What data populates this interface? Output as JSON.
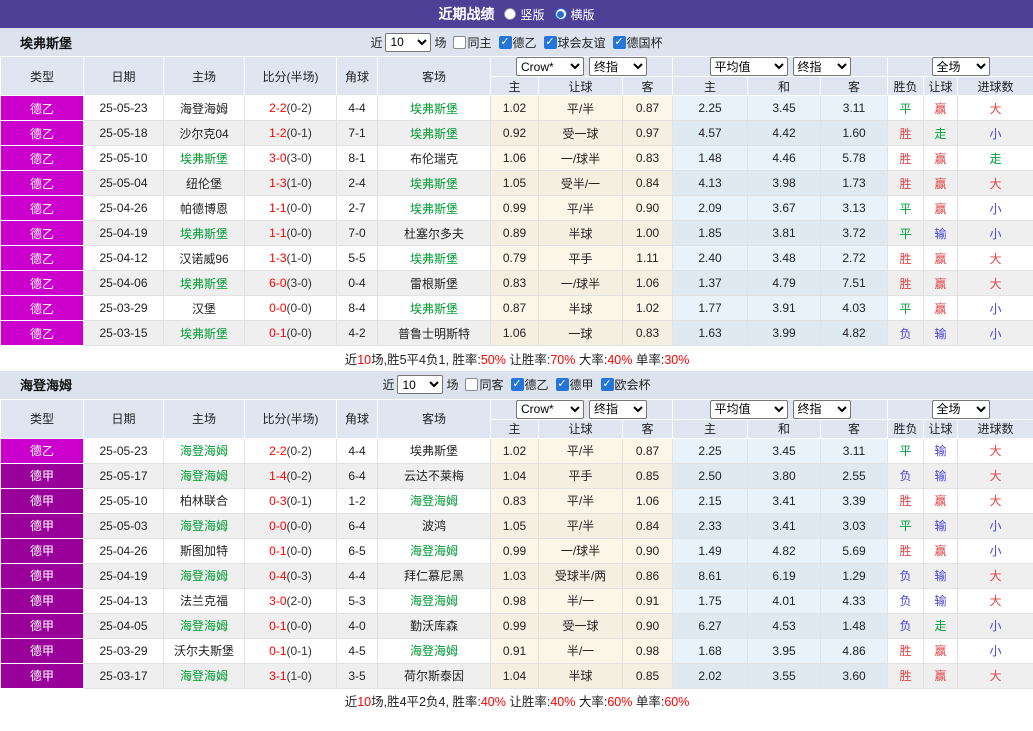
{
  "title_bar": {
    "title": "近期战绩",
    "vertical_label": "竖版",
    "vertical_checked": false,
    "horizontal_label": "横版",
    "horizontal_checked": true
  },
  "colors": {
    "topbar": "#4e4097",
    "league_de2": "#cc00cc",
    "league_de1": "#990099",
    "team_highlight": "#009933",
    "score_red": "#ff0000",
    "win_red": "#e04545",
    "draw_green": "#00a03c",
    "loss_blue": "#4545e0"
  },
  "table_header": {
    "left_cols": [
      "类型",
      "日期",
      "主场",
      "比分(半场)",
      "角球",
      "客场"
    ],
    "odds_groups": [
      {
        "selects": [
          "Crow*",
          "终指"
        ]
      },
      {
        "selects": [
          "平均值",
          "终指"
        ]
      },
      {
        "selects": [
          "全场"
        ]
      }
    ],
    "sub_cols": [
      "主",
      "让球",
      "客",
      "主",
      "和",
      "客",
      "胜负",
      "让球",
      "进球数"
    ]
  },
  "sections": [
    {
      "team": "埃弗斯堡",
      "filter": {
        "near_label": "近",
        "count": "10",
        "games_label": "场",
        "same_label": "同主",
        "same_checked": false,
        "leagues": [
          "德乙",
          "球会友谊",
          "德国杯"
        ]
      },
      "rows": [
        {
          "league": "德乙",
          "lc": "de2",
          "date": "25-05-23",
          "home": "海登海姆",
          "hg": false,
          "score": "2-2",
          "half": "(0-2)",
          "corner": "4-4",
          "away": "埃弗斯堡",
          "ag": true,
          "odds": [
            "1.02",
            "平/半",
            "0.87",
            "2.25",
            "3.45",
            "3.11"
          ],
          "results": [
            [
              "平",
              "g"
            ],
            [
              "赢",
              "r"
            ],
            [
              "大",
              "r"
            ]
          ]
        },
        {
          "league": "德乙",
          "lc": "de2",
          "date": "25-05-18",
          "home": "沙尔克04",
          "hg": false,
          "score": "1-2",
          "half": "(0-1)",
          "corner": "7-1",
          "away": "埃弗斯堡",
          "ag": true,
          "odds": [
            "0.92",
            "受一球",
            "0.97",
            "4.57",
            "4.42",
            "1.60"
          ],
          "results": [
            [
              "胜",
              "r"
            ],
            [
              "走",
              "g"
            ],
            [
              "小",
              "b"
            ]
          ]
        },
        {
          "league": "德乙",
          "lc": "de2",
          "date": "25-05-10",
          "home": "埃弗斯堡",
          "hg": true,
          "score": "3-0",
          "half": "(3-0)",
          "corner": "8-1",
          "away": "布伦瑞克",
          "ag": false,
          "odds": [
            "1.06",
            "一/球半",
            "0.83",
            "1.48",
            "4.46",
            "5.78"
          ],
          "results": [
            [
              "胜",
              "r"
            ],
            [
              "赢",
              "r"
            ],
            [
              "走",
              "g"
            ]
          ]
        },
        {
          "league": "德乙",
          "lc": "de2",
          "date": "25-05-04",
          "home": "纽伦堡",
          "hg": false,
          "score": "1-3",
          "half": "(1-0)",
          "corner": "2-4",
          "away": "埃弗斯堡",
          "ag": true,
          "odds": [
            "1.05",
            "受半/一",
            "0.84",
            "4.13",
            "3.98",
            "1.73"
          ],
          "results": [
            [
              "胜",
              "r"
            ],
            [
              "赢",
              "r"
            ],
            [
              "大",
              "r"
            ]
          ]
        },
        {
          "league": "德乙",
          "lc": "de2",
          "date": "25-04-26",
          "home": "帕德博恩",
          "hg": false,
          "score": "1-1",
          "half": "(0-0)",
          "corner": "2-7",
          "away": "埃弗斯堡",
          "ag": true,
          "odds": [
            "0.99",
            "平/半",
            "0.90",
            "2.09",
            "3.67",
            "3.13"
          ],
          "results": [
            [
              "平",
              "g"
            ],
            [
              "赢",
              "r"
            ],
            [
              "小",
              "b"
            ]
          ]
        },
        {
          "league": "德乙",
          "lc": "de2",
          "date": "25-04-19",
          "home": "埃弗斯堡",
          "hg": true,
          "score": "1-1",
          "half": "(0-0)",
          "corner": "7-0",
          "away": "杜塞尔多夫",
          "ag": false,
          "odds": [
            "0.89",
            "半球",
            "1.00",
            "1.85",
            "3.81",
            "3.72"
          ],
          "results": [
            [
              "平",
              "g"
            ],
            [
              "输",
              "b"
            ],
            [
              "小",
              "b"
            ]
          ]
        },
        {
          "league": "德乙",
          "lc": "de2",
          "date": "25-04-12",
          "home": "汉诺威96",
          "hg": false,
          "score": "1-3",
          "half": "(1-0)",
          "corner": "5-5",
          "away": "埃弗斯堡",
          "ag": true,
          "odds": [
            "0.79",
            "平手",
            "1.11",
            "2.40",
            "3.48",
            "2.72"
          ],
          "results": [
            [
              "胜",
              "r"
            ],
            [
              "赢",
              "r"
            ],
            [
              "大",
              "r"
            ]
          ]
        },
        {
          "league": "德乙",
          "lc": "de2",
          "date": "25-04-06",
          "home": "埃弗斯堡",
          "hg": true,
          "score": "6-0",
          "half": "(3-0)",
          "corner": "0-4",
          "away": "雷根斯堡",
          "ag": false,
          "odds": [
            "0.83",
            "一/球半",
            "1.06",
            "1.37",
            "4.79",
            "7.51"
          ],
          "results": [
            [
              "胜",
              "r"
            ],
            [
              "赢",
              "r"
            ],
            [
              "大",
              "r"
            ]
          ]
        },
        {
          "league": "德乙",
          "lc": "de2",
          "date": "25-03-29",
          "home": "汉堡",
          "hg": false,
          "score": "0-0",
          "half": "(0-0)",
          "corner": "8-4",
          "away": "埃弗斯堡",
          "ag": true,
          "odds": [
            "0.87",
            "半球",
            "1.02",
            "1.77",
            "3.91",
            "4.03"
          ],
          "results": [
            [
              "平",
              "g"
            ],
            [
              "赢",
              "r"
            ],
            [
              "小",
              "b"
            ]
          ]
        },
        {
          "league": "德乙",
          "lc": "de2",
          "date": "25-03-15",
          "home": "埃弗斯堡",
          "hg": true,
          "score": "0-1",
          "half": "(0-0)",
          "corner": "4-2",
          "away": "普鲁士明斯特",
          "ag": false,
          "odds": [
            "1.06",
            "一球",
            "0.83",
            "1.63",
            "3.99",
            "4.82"
          ],
          "results": [
            [
              "负",
              "b"
            ],
            [
              "输",
              "b"
            ],
            [
              "小",
              "b"
            ]
          ]
        }
      ],
      "summary": [
        [
          "近",
          "k"
        ],
        [
          "10",
          "r"
        ],
        [
          "场,胜5平4负1, 胜率:",
          "k"
        ],
        [
          "50%",
          "r"
        ],
        [
          " 让胜率:",
          "k"
        ],
        [
          "70%",
          "r"
        ],
        [
          " 大率:",
          "k"
        ],
        [
          "40%",
          "r"
        ],
        [
          " 单率:",
          "k"
        ],
        [
          "30%",
          "r"
        ]
      ]
    },
    {
      "team": "海登海姆",
      "filter": {
        "near_label": "近",
        "count": "10",
        "games_label": "场",
        "same_label": "同客",
        "same_checked": false,
        "leagues": [
          "德乙",
          "德甲",
          "欧会杯"
        ]
      },
      "rows": [
        {
          "league": "德乙",
          "lc": "de2",
          "date": "25-05-23",
          "home": "海登海姆",
          "hg": true,
          "score": "2-2",
          "half": "(0-2)",
          "corner": "4-4",
          "away": "埃弗斯堡",
          "ag": false,
          "odds": [
            "1.02",
            "平/半",
            "0.87",
            "2.25",
            "3.45",
            "3.11"
          ],
          "results": [
            [
              "平",
              "g"
            ],
            [
              "输",
              "b"
            ],
            [
              "大",
              "r"
            ]
          ]
        },
        {
          "league": "德甲",
          "lc": "de1",
          "date": "25-05-17",
          "home": "海登海姆",
          "hg": true,
          "score": "1-4",
          "half": "(0-2)",
          "corner": "6-4",
          "away": "云达不莱梅",
          "ag": false,
          "odds": [
            "1.04",
            "平手",
            "0.85",
            "2.50",
            "3.80",
            "2.55"
          ],
          "results": [
            [
              "负",
              "b"
            ],
            [
              "输",
              "b"
            ],
            [
              "大",
              "r"
            ]
          ]
        },
        {
          "league": "德甲",
          "lc": "de1",
          "date": "25-05-10",
          "home": "柏林联合",
          "hg": false,
          "score": "0-3",
          "half": "(0-1)",
          "corner": "1-2",
          "away": "海登海姆",
          "ag": true,
          "odds": [
            "0.83",
            "平/半",
            "1.06",
            "2.15",
            "3.41",
            "3.39"
          ],
          "results": [
            [
              "胜",
              "r"
            ],
            [
              "赢",
              "r"
            ],
            [
              "大",
              "r"
            ]
          ]
        },
        {
          "league": "德甲",
          "lc": "de1",
          "date": "25-05-03",
          "home": "海登海姆",
          "hg": true,
          "score": "0-0",
          "half": "(0-0)",
          "corner": "6-4",
          "away": "波鸿",
          "ag": false,
          "odds": [
            "1.05",
            "平/半",
            "0.84",
            "2.33",
            "3.41",
            "3.03"
          ],
          "results": [
            [
              "平",
              "g"
            ],
            [
              "输",
              "b"
            ],
            [
              "小",
              "b"
            ]
          ]
        },
        {
          "league": "德甲",
          "lc": "de1",
          "date": "25-04-26",
          "home": "斯图加特",
          "hg": false,
          "score": "0-1",
          "half": "(0-0)",
          "corner": "6-5",
          "away": "海登海姆",
          "ag": true,
          "odds": [
            "0.99",
            "一/球半",
            "0.90",
            "1.49",
            "4.82",
            "5.69"
          ],
          "results": [
            [
              "胜",
              "r"
            ],
            [
              "赢",
              "r"
            ],
            [
              "小",
              "b"
            ]
          ]
        },
        {
          "league": "德甲",
          "lc": "de1",
          "date": "25-04-19",
          "home": "海登海姆",
          "hg": true,
          "score": "0-4",
          "half": "(0-3)",
          "corner": "4-4",
          "away": "拜仁慕尼黑",
          "ag": false,
          "odds": [
            "1.03",
            "受球半/两",
            "0.86",
            "8.61",
            "6.19",
            "1.29"
          ],
          "results": [
            [
              "负",
              "b"
            ],
            [
              "输",
              "b"
            ],
            [
              "大",
              "r"
            ]
          ]
        },
        {
          "league": "德甲",
          "lc": "de1",
          "date": "25-04-13",
          "home": "法兰克福",
          "hg": false,
          "score": "3-0",
          "half": "(2-0)",
          "corner": "5-3",
          "away": "海登海姆",
          "ag": true,
          "odds": [
            "0.98",
            "半/一",
            "0.91",
            "1.75",
            "4.01",
            "4.33"
          ],
          "results": [
            [
              "负",
              "b"
            ],
            [
              "输",
              "b"
            ],
            [
              "大",
              "r"
            ]
          ]
        },
        {
          "league": "德甲",
          "lc": "de1",
          "date": "25-04-05",
          "home": "海登海姆",
          "hg": true,
          "score": "0-1",
          "half": "(0-0)",
          "corner": "4-0",
          "away": "勤沃库森",
          "ag": false,
          "odds": [
            "0.99",
            "受一球",
            "0.90",
            "6.27",
            "4.53",
            "1.48"
          ],
          "results": [
            [
              "负",
              "b"
            ],
            [
              "走",
              "g"
            ],
            [
              "小",
              "b"
            ]
          ]
        },
        {
          "league": "德甲",
          "lc": "de1",
          "date": "25-03-29",
          "home": "沃尔夫斯堡",
          "hg": false,
          "score": "0-1",
          "half": "(0-1)",
          "corner": "4-5",
          "away": "海登海姆",
          "ag": true,
          "odds": [
            "0.91",
            "半/一",
            "0.98",
            "1.68",
            "3.95",
            "4.86"
          ],
          "results": [
            [
              "胜",
              "r"
            ],
            [
              "赢",
              "r"
            ],
            [
              "小",
              "b"
            ]
          ]
        },
        {
          "league": "德甲",
          "lc": "de1",
          "date": "25-03-17",
          "home": "海登海姆",
          "hg": true,
          "score": "3-1",
          "half": "(1-0)",
          "corner": "3-5",
          "away": "荷尔斯泰因",
          "ag": false,
          "odds": [
            "1.04",
            "半球",
            "0.85",
            "2.02",
            "3.55",
            "3.60"
          ],
          "results": [
            [
              "胜",
              "r"
            ],
            [
              "赢",
              "r"
            ],
            [
              "大",
              "r"
            ]
          ]
        }
      ],
      "summary": [
        [
          "近",
          "k"
        ],
        [
          "10",
          "r"
        ],
        [
          "场,胜4平2负4, 胜率:",
          "k"
        ],
        [
          "40%",
          "r"
        ],
        [
          " 让胜率:",
          "k"
        ],
        [
          "40%",
          "r"
        ],
        [
          " 大率:",
          "k"
        ],
        [
          "60%",
          "r"
        ],
        [
          " 单率:",
          "k"
        ],
        [
          "60%",
          "r"
        ]
      ]
    }
  ]
}
